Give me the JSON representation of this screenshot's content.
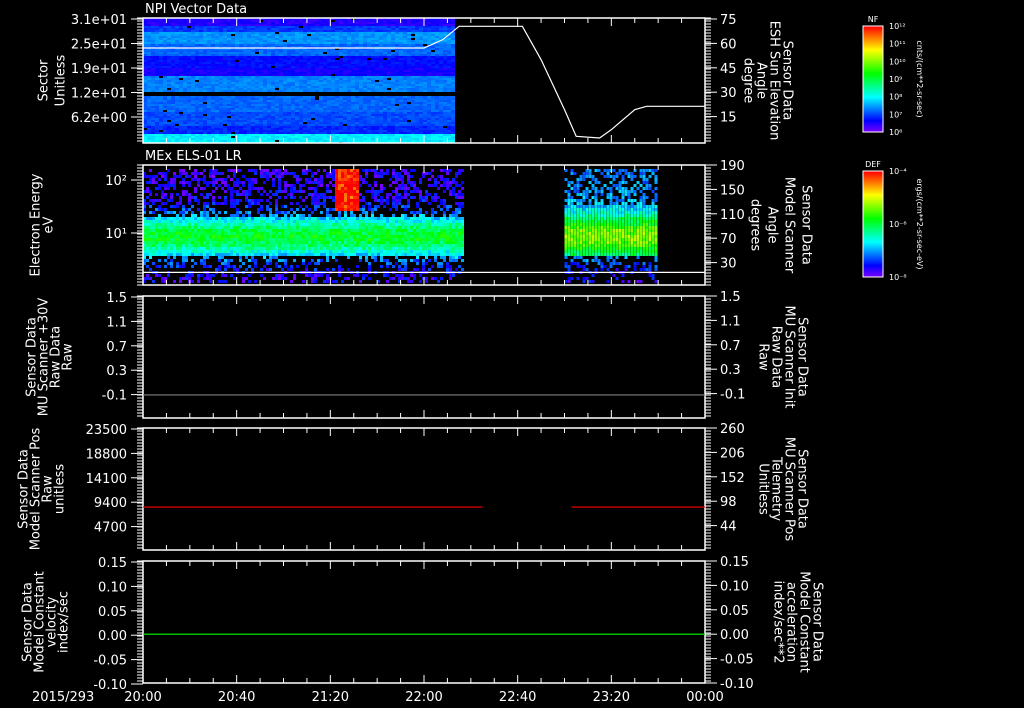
{
  "date_label": "2015/293",
  "time_ticks": [
    "20:00",
    "20:40",
    "21:20",
    "22:00",
    "22:40",
    "23:20",
    "00:00"
  ],
  "colors": {
    "axis": "#ffffff",
    "red": "#ff0000",
    "green": "#00ff00",
    "grey": "#808080"
  },
  "chart_data": [
    {
      "type": "heatmap",
      "title": "NPI Vector Data",
      "ylabel": [
        "Sector",
        "Unitless"
      ],
      "yticks": [
        "3.1e+01",
        "2.5e+01",
        "1.9e+01",
        "1.2e+01",
        "6.2e+00"
      ],
      "data_time_range": [
        "20:00",
        "22:13"
      ],
      "colorbar": {
        "label": "NF",
        "units": "cnts/(cm**2-sr-sec)",
        "ticks": [
          "10¹²",
          "10¹¹",
          "10¹⁰",
          "10⁹",
          "10⁸",
          "10⁷",
          "10⁶"
        ]
      },
      "overlay": {
        "type": "line",
        "ylabel": [
          "Sensor Data",
          "ESH Sun Elevation",
          "Angle",
          "degree"
        ],
        "yticks": [
          "75",
          "60",
          "45",
          "30",
          "15"
        ],
        "ylim": [
          0,
          75
        ],
        "points": [
          [
            "20:00",
            57
          ],
          [
            "22:00",
            57
          ],
          [
            "22:08",
            62
          ],
          [
            "22:15",
            70
          ],
          [
            "22:42",
            70
          ],
          [
            "22:50",
            50
          ],
          [
            "23:00",
            20
          ],
          [
            "23:05",
            4
          ],
          [
            "23:15",
            3
          ],
          [
            "23:20",
            8
          ],
          [
            "23:30",
            20
          ],
          [
            "23:35",
            22
          ],
          [
            "00:00",
            22
          ]
        ]
      }
    },
    {
      "type": "heatmap",
      "title": "MEx ELS-01 LR",
      "ylabel": [
        "Electron Energy",
        "eV"
      ],
      "yticks": [
        "10²",
        "10¹"
      ],
      "data_time_ranges": [
        [
          "20:00",
          "22:16"
        ],
        [
          "23:00",
          "23:39"
        ]
      ],
      "colorbar": {
        "label": "DEF",
        "units": "ergs/(cm**2-sr-sec-eV)",
        "ticks": [
          "10⁻⁴",
          "10⁻⁶",
          "10⁻⁸"
        ]
      },
      "overlay": {
        "type": "line",
        "ylabel": [
          "Sensor Data",
          "Model Scanner",
          "Angle",
          "degrees"
        ],
        "yticks": [
          "190",
          "150",
          "110",
          "70",
          "30"
        ],
        "ylim": [
          10,
          190
        ],
        "points": [
          [
            "20:00",
            20
          ],
          [
            "00:00",
            20
          ]
        ]
      }
    },
    {
      "type": "line",
      "ylabel": [
        "Sensor Data",
        "MU Scanner +30V",
        "Raw Data",
        "Raw"
      ],
      "yticks": [
        "1.5",
        "1.1",
        "0.7",
        "0.3",
        "-0.1"
      ],
      "ylim": [
        -0.35,
        1.5
      ],
      "series": [
        {
          "name": "MU Scanner +30V",
          "color": "#808080",
          "points": [
            [
              "20:00",
              0
            ],
            [
              "00:00",
              0
            ]
          ]
        }
      ],
      "right": {
        "ylabel": [
          "Sensor Data",
          "MU Scanner Init",
          "Raw Data",
          "Raw"
        ],
        "yticks": [
          "1.5",
          "1.1",
          "0.7",
          "0.3",
          "-0.1"
        ]
      }
    },
    {
      "type": "line",
      "ylabel": [
        "Sensor Data",
        "Model Scanner Pos",
        "Raw",
        "unitless"
      ],
      "yticks": [
        "23500",
        "18800",
        "14100",
        "9400",
        "4700"
      ],
      "ylim": [
        0,
        23500
      ],
      "series": [
        {
          "name": "MU Scanner Pos Telemetry",
          "color": "#ff0000",
          "segments": [
            [
              [
                "20:00",
                85
              ],
              [
                "22:25",
                85
              ]
            ],
            [
              [
                "23:03",
                85
              ],
              [
                "00:00",
                85
              ]
            ]
          ]
        }
      ],
      "right": {
        "ylabel": [
          "Sensor Data",
          "MU Scanner Pos",
          "Telemetry",
          "Unitless"
        ],
        "yticks": [
          "260",
          "206",
          "152",
          "98",
          "44"
        ],
        "ylim": [
          -10,
          260
        ]
      }
    },
    {
      "type": "line",
      "ylabel": [
        "Sensor Data",
        "Model Constant",
        "velocity",
        "index/sec"
      ],
      "yticks": [
        "0.15",
        "0.10",
        "0.05",
        "0.00",
        "-0.05",
        "-0.10"
      ],
      "ylim": [
        -0.1,
        0.15
      ],
      "series": [
        {
          "name": "Model Constant acceleration",
          "color": "#00ff00",
          "points": [
            [
              "20:00",
              0
            ],
            [
              "00:00",
              0
            ]
          ]
        }
      ],
      "right": {
        "ylabel": [
          "Sensor Data",
          "Model Constant",
          "acceleration",
          "index/sec**2"
        ],
        "yticks": [
          "0.15",
          "0.10",
          "0.05",
          "0.00",
          "-0.05",
          "-0.10"
        ]
      }
    }
  ]
}
